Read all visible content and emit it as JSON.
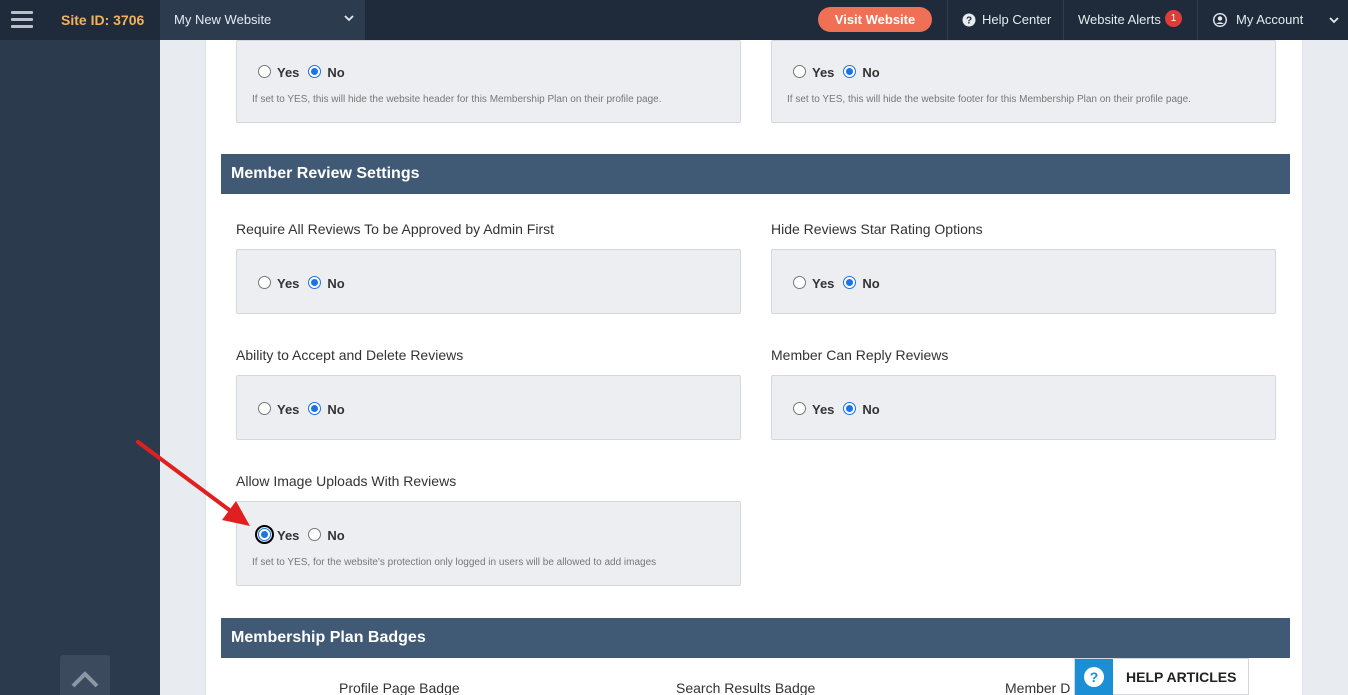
{
  "topbar": {
    "site_id": "Site ID: 3706",
    "site_select": "My New Website",
    "visit_button": "Visit Website",
    "help_center": "Help Center",
    "website_alerts": "Website Alerts",
    "alerts_count": "1",
    "my_account": "My Account"
  },
  "top_boxes": {
    "left": {
      "yes": "Yes",
      "no": "No",
      "selected": "No",
      "help": "If set to YES, this will hide the website header for this Membership Plan on their profile page."
    },
    "right": {
      "yes": "Yes",
      "no": "No",
      "selected": "No",
      "help": "If set to YES, this will hide the website footer for this Membership Plan on their profile page."
    }
  },
  "review_settings": {
    "heading": "Member Review Settings",
    "fields": [
      {
        "label": "Require All Reviews To be Approved by Admin First",
        "yes": "Yes",
        "no": "No",
        "selected": "No"
      },
      {
        "label": "Hide Reviews Star Rating Options",
        "yes": "Yes",
        "no": "No",
        "selected": "No"
      },
      {
        "label": "Ability to Accept and Delete Reviews",
        "yes": "Yes",
        "no": "No",
        "selected": "No"
      },
      {
        "label": "Member Can Reply Reviews",
        "yes": "Yes",
        "no": "No",
        "selected": "No"
      },
      {
        "label": "Allow Image Uploads With Reviews",
        "yes": "Yes",
        "no": "No",
        "selected": "Yes",
        "help": "If set to YES, for the website's protection only logged in users will be allowed to add images"
      }
    ]
  },
  "badges": {
    "heading": "Membership Plan Badges",
    "labels": [
      "Profile Page Badge",
      "Search Results Badge",
      "Member D"
    ]
  },
  "help_widget": {
    "icon": "?",
    "label": "HELP ARTICLES"
  },
  "colors": {
    "topbar": "#1f2b3a",
    "sidebar": "#2b3a4c",
    "section_header": "#405a75",
    "visit_button": "#f07055",
    "accent": "#1a73e8",
    "annotation_arrow": "#e02020"
  }
}
